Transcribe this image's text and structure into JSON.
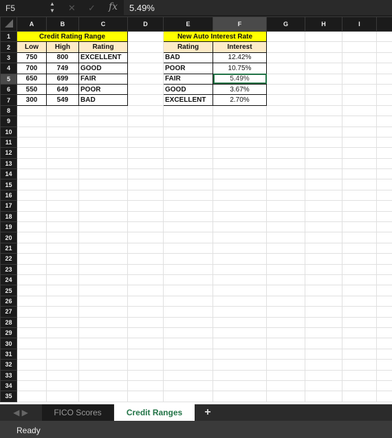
{
  "formula_bar": {
    "name_box": "F5",
    "formula": "5.49%",
    "fx_label": "fx"
  },
  "columns": [
    "A",
    "B",
    "C",
    "D",
    "E",
    "F",
    "G",
    "H",
    "I"
  ],
  "selected_column": "F",
  "selected_row": 5,
  "row_count": 35,
  "credit_table": {
    "title": "Credit Rating Range",
    "headers": [
      "Low",
      "High",
      "Rating"
    ],
    "rows": [
      [
        "750",
        "800",
        "EXCELLENT"
      ],
      [
        "700",
        "749",
        "GOOD"
      ],
      [
        "650",
        "699",
        "FAIR"
      ],
      [
        "550",
        "649",
        "POOR"
      ],
      [
        "300",
        "549",
        "BAD"
      ]
    ]
  },
  "interest_table": {
    "title": "New Auto Interest Rate",
    "headers": [
      "Rating",
      "Interest"
    ],
    "rows": [
      [
        "BAD",
        "12.42%"
      ],
      [
        "POOR",
        "10.75%"
      ],
      [
        "FAIR",
        "5.49%"
      ],
      [
        "GOOD",
        "3.67%"
      ],
      [
        "EXCELLENT",
        "2.70%"
      ]
    ]
  },
  "sheet_tabs": [
    {
      "label": "FICO Scores",
      "active": false
    },
    {
      "label": "Credit Ranges",
      "active": true
    }
  ],
  "add_sheet_label": "+",
  "status": "Ready",
  "colors": {
    "accent": "#217346",
    "title_fill": "#ffff00",
    "header_fill": "#fdebc8"
  }
}
